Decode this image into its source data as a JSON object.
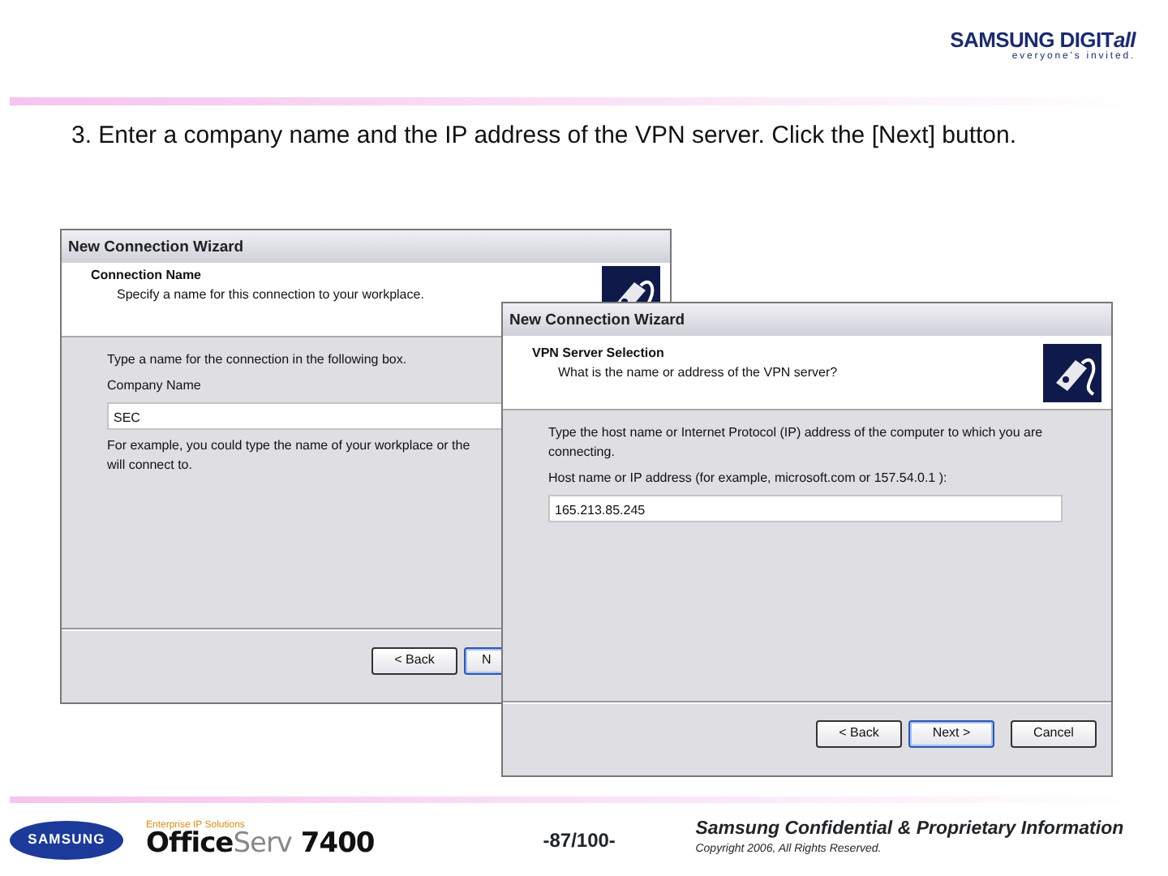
{
  "header": {
    "logo": "SAMSUNG DIGIT",
    "logo_suffix": "all",
    "tagline": "everyone's invited."
  },
  "instruction": "3. Enter a company name and the IP address of the VPN server. Click the [Next] button.",
  "dialogs": [
    {
      "title": "New Connection Wizard",
      "heading": "Connection Name",
      "subheading": "Specify a name for this connection to your workplace.",
      "prompt": "Type a name for the connection in the following box.",
      "label": "Company Name",
      "value": "SEC",
      "notes": [
        "For example, you could type the name of your workplace or the",
        "will connect to."
      ],
      "buttons": [
        {
          "label": "< Back",
          "default": false
        },
        {
          "label": "N",
          "default": true
        }
      ]
    },
    {
      "title": "New Connection Wizard",
      "heading": "VPN Server Selection",
      "subheading": "What is the name or address of the VPN server?",
      "prompt": "Type the host name or Internet Protocol (IP) address of the computer to which you are connecting.",
      "label": "Host name or IP address (for example, microsoft.com or 157.54.0.1 ):",
      "value": "165.213.85.245",
      "buttons": [
        {
          "label": "< Back",
          "default": false
        },
        {
          "label": "Next >",
          "default": true
        },
        {
          "label": "Cancel",
          "default": false
        }
      ]
    }
  ],
  "footer": {
    "brand": "SAMSUNG",
    "product_tagline": "Enterprise IP Solutions",
    "product_name": "Office",
    "product_line": "Serv",
    "product_model": "7400",
    "page": "-87/100-",
    "confidential": "Samsung Confidential & Proprietary Information",
    "copyright": "Copyright 2006, All Rights Reserved."
  }
}
